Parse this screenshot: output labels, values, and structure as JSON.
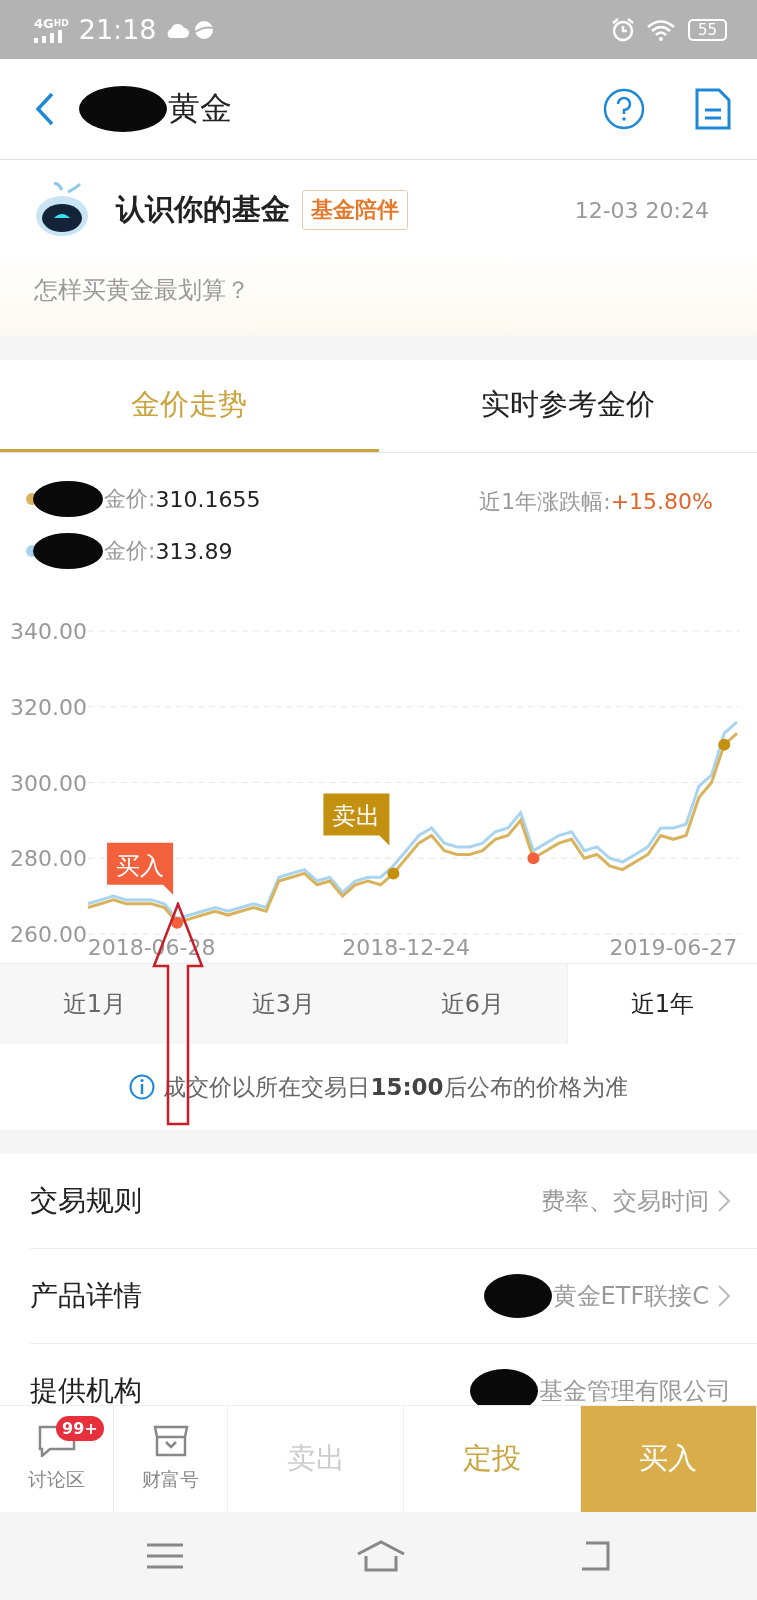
{
  "status_bar": {
    "network": "4G",
    "network_extra": "HD",
    "time": "21:18",
    "battery": "55"
  },
  "header": {
    "title": "黄金"
  },
  "news_card": {
    "title": "认识你的基金",
    "tag": "基金陪伴",
    "time": "12-03 20:24",
    "question": "怎样买黄金最划算？"
  },
  "tabs": [
    {
      "label": "金价走势",
      "selected": true
    },
    {
      "label": "实时参考金价",
      "selected": false
    }
  ],
  "legend": [
    {
      "label": "金价:",
      "value": "310.1655",
      "color": "#d9b25c"
    },
    {
      "label": "金价:",
      "value": "313.89",
      "color": "#a9d4f0"
    }
  ],
  "change": {
    "label": "近1年涨跌幅:",
    "value": "+15.80%"
  },
  "chart_data": {
    "type": "line",
    "categories": [
      null,
      null,
      null,
      null,
      null,
      "2018-06-28",
      null,
      null,
      null,
      null,
      null,
      null,
      null,
      null,
      null,
      null,
      null,
      null,
      null,
      null,
      null,
      null,
      null,
      null,
      null,
      "2018-12-24",
      null,
      null,
      null,
      null,
      null,
      null,
      null,
      null,
      null,
      null,
      null,
      null,
      null,
      null,
      null,
      null,
      null,
      null,
      null,
      null,
      "2019-06-27",
      null,
      null,
      null,
      null,
      null
    ],
    "series": [
      {
        "color": "#a9d4f0",
        "values": [
          268,
          269,
          270,
          269,
          269,
          269,
          268,
          264,
          265,
          266,
          267,
          266,
          267,
          268,
          267,
          275,
          276,
          277,
          274,
          275,
          271,
          274,
          275,
          275,
          278,
          282,
          286,
          288,
          284,
          283,
          283,
          284,
          287,
          288,
          292,
          282,
          284,
          286,
          287,
          282,
          283,
          280,
          279,
          281,
          283,
          288,
          288,
          289,
          299,
          302,
          313,
          316
        ]
      },
      {
        "color": "#d9b25c",
        "values": [
          267,
          268,
          269,
          268,
          268,
          268,
          267,
          263,
          264,
          265,
          266,
          265,
          266,
          267,
          266,
          274,
          275,
          276,
          273,
          274,
          270,
          273,
          274,
          273,
          276,
          280,
          284,
          286,
          282,
          281,
          281,
          282,
          285,
          286,
          290,
          280,
          282,
          284,
          285,
          280,
          281,
          278,
          277,
          279,
          281,
          286,
          285,
          286,
          296,
          300,
          310,
          313
        ]
      }
    ],
    "ylim": [
      260,
      340
    ],
    "yticks": [
      {
        "value": 260,
        "label": "260.00"
      },
      {
        "value": 280,
        "label": "280.00"
      },
      {
        "value": 300,
        "label": "300.00"
      },
      {
        "value": 320,
        "label": "320.00"
      },
      {
        "value": 340,
        "label": "340.00"
      }
    ],
    "grid": true
  },
  "trade_markers": [
    {
      "kind": "buy",
      "label": "买入"
    },
    {
      "kind": "sell",
      "label": "卖出"
    },
    {
      "kind": "buy"
    },
    {
      "kind": "sell"
    }
  ],
  "periods": [
    {
      "label": "近1月",
      "selected": false
    },
    {
      "label": "近3月",
      "selected": false
    },
    {
      "label": "近6月",
      "selected": false
    },
    {
      "label": "近1年",
      "selected": true
    }
  ],
  "note": "成交价以所在交易日**15:00**后公布的价格为准",
  "info_rows": [
    {
      "label": "交易规则",
      "value": "费率、交易时间",
      "arrow": true,
      "redacted": false
    },
    {
      "label": "产品详情",
      "value": "黄金ETF联接C",
      "arrow": true,
      "redacted": true
    },
    {
      "label": "提供机构",
      "value": "基金管理有限公司",
      "arrow": false,
      "redacted": true
    }
  ],
  "bottom_bar": [
    {
      "kind": "icon-tab",
      "label": "讨论区",
      "badge": "99+"
    },
    {
      "kind": "icon-tab",
      "label": "财富号"
    },
    {
      "kind": "action",
      "label": "卖出",
      "disabled": true
    },
    {
      "kind": "action",
      "label": "定投",
      "disabled": false
    },
    {
      "kind": "primary",
      "label": "买入"
    }
  ]
}
